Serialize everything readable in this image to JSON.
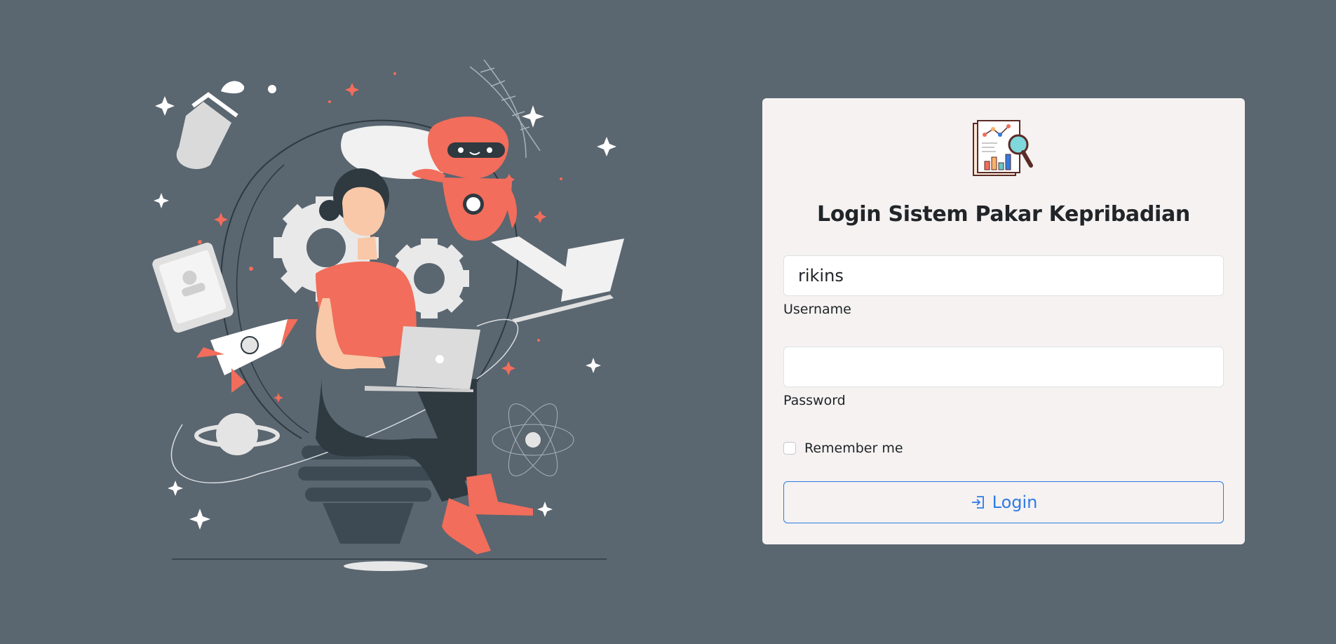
{
  "illustration": {
    "icon": "person-with-laptop-illustration"
  },
  "login_card": {
    "logo_icon": "report-magnifier-icon",
    "title": "Login Sistem Pakar Kepribadian",
    "username": {
      "value": "rikins",
      "label": "Username"
    },
    "password": {
      "value": "",
      "label": "Password"
    },
    "remember_me": {
      "label": "Remember me",
      "checked": false
    },
    "login_button": {
      "label": "Login",
      "icon": "sign-in-icon"
    }
  },
  "colors": {
    "background": "#5a6670",
    "card": "#f5f2f1",
    "accent": "#2f7be5",
    "illustration_coral": "#f26d5b"
  }
}
